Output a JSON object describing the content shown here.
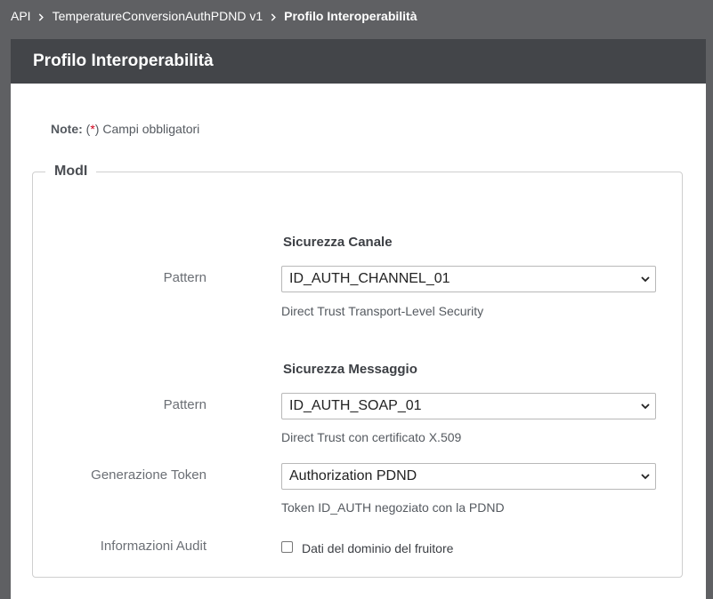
{
  "breadcrumb": {
    "items": [
      "API",
      "TemperatureConversionAuthPDND v1"
    ],
    "current": "Profilo Interoperabilità"
  },
  "card": {
    "title": "Profilo Interoperabilità"
  },
  "note": {
    "label": "Note:",
    "open": "(",
    "star": "*",
    "text": ") Campi obbligatori"
  },
  "fieldset": {
    "legend": "ModI"
  },
  "sicurezza_canale": {
    "title": "Sicurezza Canale",
    "pattern_label": "Pattern",
    "pattern_value": "ID_AUTH_CHANNEL_01",
    "pattern_hint": "Direct Trust Transport-Level Security"
  },
  "sicurezza_messaggio": {
    "title": "Sicurezza Messaggio",
    "pattern_label": "Pattern",
    "pattern_value": "ID_AUTH_SOAP_01",
    "pattern_hint": "Direct Trust con certificato X.509",
    "token_label": "Generazione Token",
    "token_value": "Authorization PDND",
    "token_hint": "Token ID_AUTH negoziato con la PDND",
    "audit_label": "Informazioni Audit",
    "audit_checkbox_label": "Dati del dominio del fruitore",
    "audit_checked": false
  },
  "colors": {
    "top_bar": "#5f6063",
    "card_header": "#434549",
    "required_star": "#d0021b"
  }
}
